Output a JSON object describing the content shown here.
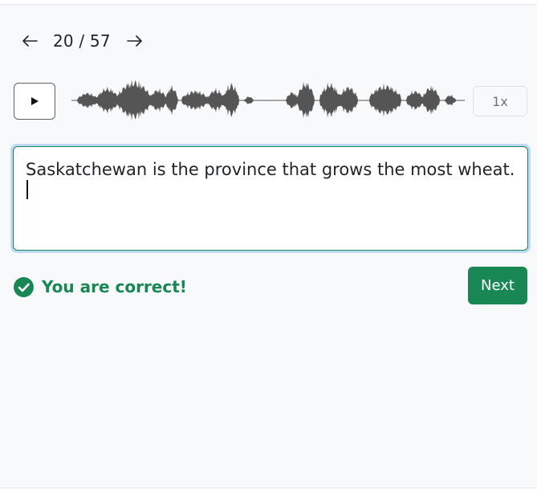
{
  "navigation": {
    "current": "20",
    "separator": "/",
    "total": "57",
    "counter_text": "20 / 57",
    "prev_icon": "arrow-left-icon",
    "next_icon": "arrow-right-icon"
  },
  "player": {
    "play_icon": "play-icon",
    "speed_label": "1x",
    "waveform_color": "#555555"
  },
  "answer": {
    "text": "Saskatchewan is the province that grows the most wheat."
  },
  "feedback": {
    "icon": "check-circle-icon",
    "message": "You are correct!",
    "color": "#198754"
  },
  "actions": {
    "next_label": "Next",
    "accent_color": "#198754"
  }
}
